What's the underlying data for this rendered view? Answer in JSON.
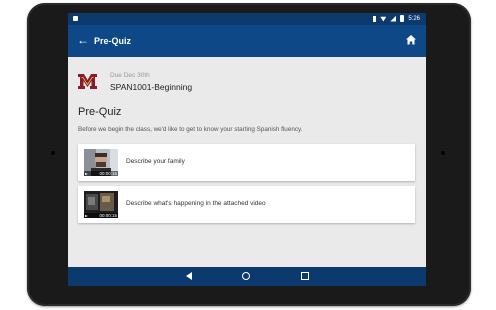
{
  "status_bar": {
    "time": "5:26",
    "icons": [
      "notification-icon",
      "bluetooth-icon",
      "wifi-icon",
      "signal-icon",
      "battery-icon"
    ]
  },
  "app_bar": {
    "back_icon": "arrow-back-icon",
    "title": "Pre-Quiz",
    "home_icon": "home-icon",
    "color": "#0e4887"
  },
  "course": {
    "logo": "university-m-logo",
    "due": "Due Dec 30th",
    "name": "SPAN1001-Beginning"
  },
  "quiz": {
    "title": "Pre-Quiz",
    "description": "Before we begin the class, we'd like to get to know your starting Spanish fluency."
  },
  "items": [
    {
      "label": "Describe your family",
      "duration": "00:00:15"
    },
    {
      "label": "Describe what's happening in the attached video",
      "duration": "00:00:15"
    }
  ],
  "nav_bar": {
    "icons": [
      "back-triangle-icon",
      "home-circle-icon",
      "recents-square-icon"
    ]
  },
  "colors": {
    "brand_dark": "#0d3a6e",
    "logo_maroon": "#8b1a2b",
    "logo_gold": "#f2c230"
  }
}
